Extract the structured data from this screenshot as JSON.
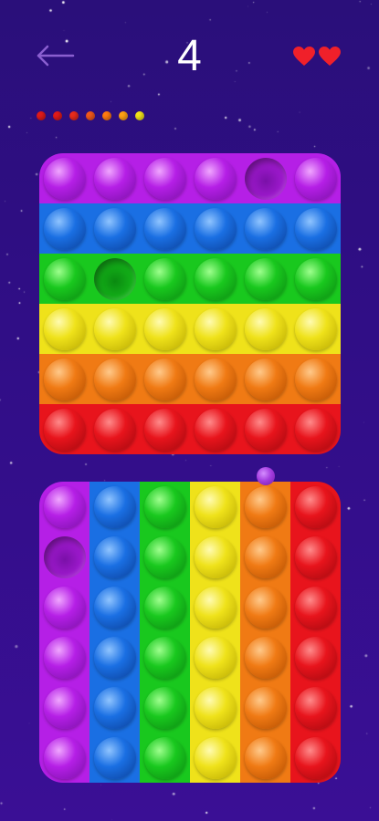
{
  "header": {
    "level": "4",
    "lives": 2
  },
  "progress": {
    "colors": [
      "#e01a1a",
      "#e01a1a",
      "#e82b1c",
      "#f0581a",
      "#ff7a10",
      "#ffa114",
      "#f2e21a"
    ]
  },
  "palette": [
    {
      "name": "purple",
      "base": "#b51fe6",
      "light": "#f0a6ff",
      "dark": "#7a10a8"
    },
    {
      "name": "blue",
      "base": "#1a6fe3",
      "light": "#8fc4ff",
      "dark": "#0b3f99"
    },
    {
      "name": "green",
      "base": "#19c81e",
      "light": "#9dff8d",
      "dark": "#0a8a10"
    },
    {
      "name": "yellow",
      "base": "#efe21a",
      "light": "#fffbb0",
      "dark": "#b8a800"
    },
    {
      "name": "orange",
      "base": "#f07a14",
      "light": "#ffc98a",
      "dark": "#b34d00"
    },
    {
      "name": "red",
      "base": "#e8141c",
      "light": "#ff8a8a",
      "dark": "#a3080e"
    }
  ],
  "boards": [
    {
      "id": "board-rows",
      "orientation": "rows",
      "popped": [
        [
          0,
          4
        ],
        [
          2,
          1
        ]
      ]
    },
    {
      "id": "board-cols",
      "orientation": "columns",
      "popped": [
        [
          1,
          0
        ]
      ]
    }
  ]
}
